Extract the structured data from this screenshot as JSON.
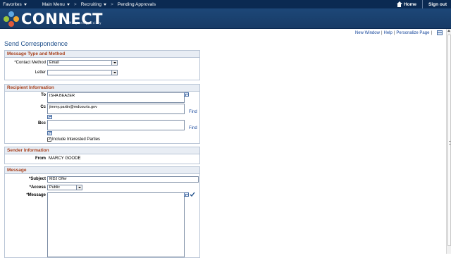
{
  "topnav": {
    "favorites": "Favorites",
    "main_menu": "Main Menu",
    "recruiting": "Recruiting",
    "pending_approvals": "Pending Approvals",
    "separator": ">",
    "home": "Home",
    "sign_out": "Sign out"
  },
  "banner": {
    "logo_text": "CONNECT",
    "logo_subtitle": "Maryland Judiciary"
  },
  "pagelinks": {
    "new_window": "New Window",
    "help": "Help",
    "personalize": "Personalize Page",
    "separator": "|"
  },
  "page_title": "Send Correspondence",
  "message_type": {
    "heading": "Message Type and Method",
    "contact_method_label": "*Contact Method",
    "contact_method_value": "Email",
    "letter_label": "Letter",
    "letter_value": ""
  },
  "recipient": {
    "heading": "Recipient Information",
    "to_label": "To",
    "to_value": "ISHA BEAZER",
    "cc_label": "Cc",
    "cc_value": "jimmy.partin@mdcourts.gov",
    "bcc_label": "Bcc",
    "bcc_value": "",
    "find_label": "Find",
    "include_parties_label": "Include Interested Parties",
    "include_parties_checked": true
  },
  "sender": {
    "heading": "Sender Information",
    "from_label": "From",
    "from_value": "MARCY GOODE"
  },
  "message": {
    "heading": "Message",
    "subject_label": "*Subject",
    "subject_value": "MDJ Offer",
    "access_label": "*Access",
    "access_value": "Public",
    "message_label": "*Message",
    "message_value": ""
  },
  "colors": {
    "nav_bg": "#0b2a52",
    "banner_bg": "#1d4778",
    "group_heading": "#a8401c",
    "link": "#14459b",
    "title": "#1f4f8a"
  }
}
